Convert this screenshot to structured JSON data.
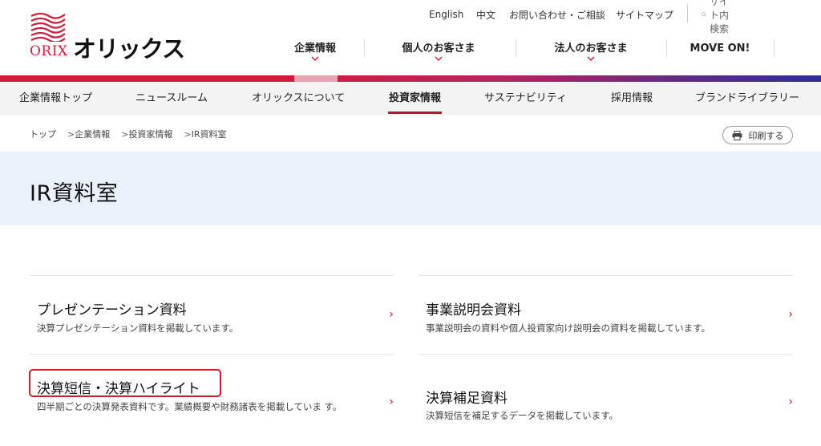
{
  "brand": {
    "logo_text_en": "ORIX",
    "logo_text_jp": "オリックス",
    "accent": "#c8102e"
  },
  "utility": {
    "english": "English",
    "chinese": "中文",
    "contact": "お問い合わせ・ご相談",
    "sitemap": "サイトマップ",
    "search_placeholder": "サイト内検索"
  },
  "gnav": [
    {
      "label": "企業情報",
      "has_chevron": true
    },
    {
      "label": "個人のお客さま",
      "has_chevron": true
    },
    {
      "label": "法人のお客さま",
      "has_chevron": true
    },
    {
      "label": "MOVE ON!",
      "has_chevron": false
    }
  ],
  "subnav": [
    {
      "label": "企業情報トップ"
    },
    {
      "label": "ニュースルーム"
    },
    {
      "label": "オリックスについて"
    },
    {
      "label": "投資家情報",
      "active": true
    },
    {
      "label": "サステナビリティ"
    },
    {
      "label": "採用情報"
    },
    {
      "label": "ブランドライブラリー"
    }
  ],
  "breadcrumb": [
    "トップ",
    "企業情報",
    "投資家情報",
    "IR資料室"
  ],
  "breadcrumb_sep": ">",
  "print_label": "印刷する",
  "page_title": "IR資料室",
  "cards": [
    {
      "title": "プレゼンテーション資料",
      "desc": "決算プレゼンテーション資料を掲載しています。"
    },
    {
      "title": "事業説明会資料",
      "desc": "事業説明会の資料や個人投資家向け説明会の資料を掲載しています。"
    },
    {
      "title": "決算短信・決算ハイライト",
      "desc": "四半期ごとの決算発表資料です。業績概要や財務諸表を掲載していま す。"
    },
    {
      "title": "決算補足資料",
      "desc": "決算短信を補足するデータを掲載しています。"
    }
  ],
  "arrow_glyph": "›"
}
